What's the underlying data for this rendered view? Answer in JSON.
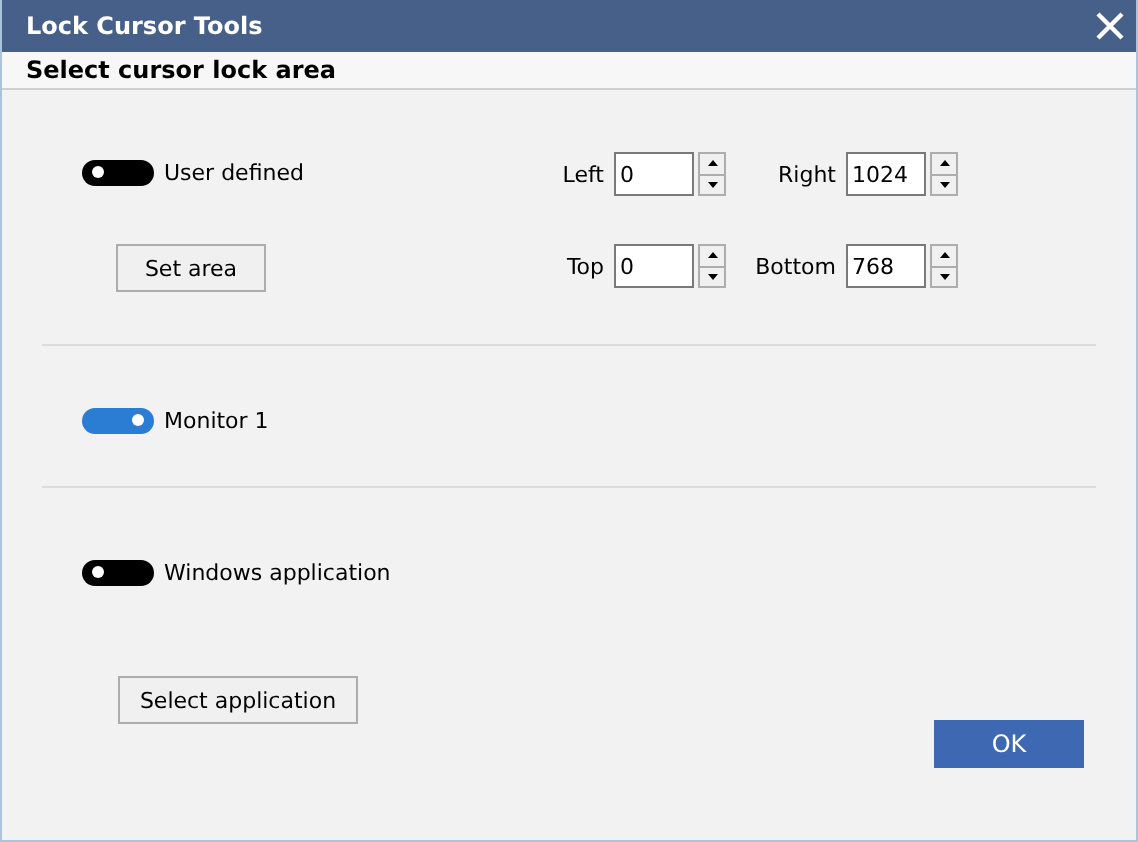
{
  "window": {
    "title": "Lock Cursor Tools"
  },
  "section_header": "Select cursor lock area",
  "user_defined": {
    "toggle": {
      "label": "User defined",
      "on": false
    },
    "button": "Set area",
    "fields": [
      {
        "label": "Left",
        "value": "0"
      },
      {
        "label": "Right",
        "value": "1024"
      },
      {
        "label": "Top",
        "value": "0"
      },
      {
        "label": "Bottom",
        "value": "768"
      }
    ]
  },
  "monitor": {
    "toggle": {
      "label": "Monitor 1",
      "on": true
    }
  },
  "application": {
    "toggle": {
      "label": "Windows application",
      "on": false
    },
    "button": "Select application"
  },
  "buttons": [
    "OK"
  ]
}
